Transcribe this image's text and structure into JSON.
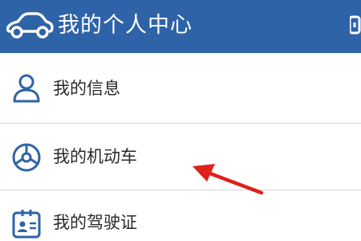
{
  "header": {
    "title": "我的个人中心",
    "logo_icon": "car-outline-icon",
    "right_icon": "partial-icon",
    "background_color": "#2f63a8"
  },
  "menu": {
    "items": [
      {
        "label": "我的信息",
        "icon": "user-icon"
      },
      {
        "label": "我的机动车",
        "icon": "steering-wheel-icon"
      },
      {
        "label": "我的驾驶证",
        "icon": "id-card-icon"
      }
    ],
    "icon_color": "#2f63a8"
  },
  "annotation": {
    "arrow_color": "#e0201b"
  }
}
